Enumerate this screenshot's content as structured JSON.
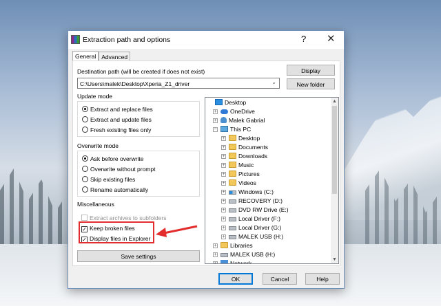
{
  "dialog": {
    "title": "Extraction path and options",
    "help_glyph": "?",
    "close_glyph": "✕"
  },
  "tabs": [
    {
      "label": "General",
      "active": true
    },
    {
      "label": "Advanced",
      "active": false
    }
  ],
  "destination": {
    "label": "Destination path (will be created if does not exist)",
    "value": "C:\\Users\\malek\\Desktop\\Xperia_Z1_driver"
  },
  "side_buttons": {
    "display": "Display",
    "new_folder": "New folder"
  },
  "update_mode": {
    "title": "Update mode",
    "options": [
      {
        "label": "Extract and replace files",
        "selected": true
      },
      {
        "label": "Extract and update files",
        "selected": false
      },
      {
        "label": "Fresh existing files only",
        "selected": false
      }
    ]
  },
  "overwrite_mode": {
    "title": "Overwrite mode",
    "options": [
      {
        "label": "Ask before overwrite",
        "selected": true
      },
      {
        "label": "Overwrite without prompt",
        "selected": false
      },
      {
        "label": "Skip existing files",
        "selected": false
      },
      {
        "label": "Rename automatically",
        "selected": false
      }
    ]
  },
  "misc": {
    "title": "Miscellaneous",
    "options": [
      {
        "label": "Extract archives to subfolders",
        "checked": false,
        "enabled": false
      },
      {
        "label": "Keep broken files",
        "checked": true,
        "enabled": true
      },
      {
        "label": "Display files in Explorer",
        "checked": true,
        "enabled": true
      }
    ]
  },
  "save_settings": "Save settings",
  "tree": {
    "items": [
      {
        "label": "Desktop",
        "icon": "desktop-icon",
        "level": 0
      },
      {
        "label": "OneDrive",
        "icon": "cloud-icon",
        "level": 1
      },
      {
        "label": "Malek Gabrial",
        "icon": "user-icon",
        "level": 1
      },
      {
        "label": "This PC",
        "icon": "pc-icon",
        "level": 1
      },
      {
        "label": "Desktop",
        "icon": "folder-icon",
        "level": 2
      },
      {
        "label": "Documents",
        "icon": "folder-icon",
        "level": 2
      },
      {
        "label": "Downloads",
        "icon": "folder-icon",
        "level": 2
      },
      {
        "label": "Music",
        "icon": "music-icon",
        "level": 2
      },
      {
        "label": "Pictures",
        "icon": "folder-icon",
        "level": 2
      },
      {
        "label": "Videos",
        "icon": "folder-icon",
        "level": 2
      },
      {
        "label": "Windows (C:)",
        "icon": "windows-drive-icon",
        "level": 2
      },
      {
        "label": "RECOVERY (D:)",
        "icon": "drive-icon",
        "level": 2
      },
      {
        "label": "DVD RW Drive (E:)",
        "icon": "dvd-icon",
        "level": 2
      },
      {
        "label": "Local Driver (F:)",
        "icon": "drive-icon",
        "level": 2
      },
      {
        "label": "Local Driver (G:)",
        "icon": "drive-icon",
        "level": 2
      },
      {
        "label": "MALEK USB (H:)",
        "icon": "usb-icon",
        "level": 2
      },
      {
        "label": "Libraries",
        "icon": "folder-icon",
        "level": 1
      },
      {
        "label": "MALEK USB (H:)",
        "icon": "usb-icon",
        "level": 1
      },
      {
        "label": "Network",
        "icon": "network-icon",
        "level": 1
      }
    ]
  },
  "footer": {
    "ok": "OK",
    "cancel": "Cancel",
    "help": "Help"
  },
  "colors": {
    "highlight": "#e32c2c",
    "accent": "#0078d7"
  }
}
